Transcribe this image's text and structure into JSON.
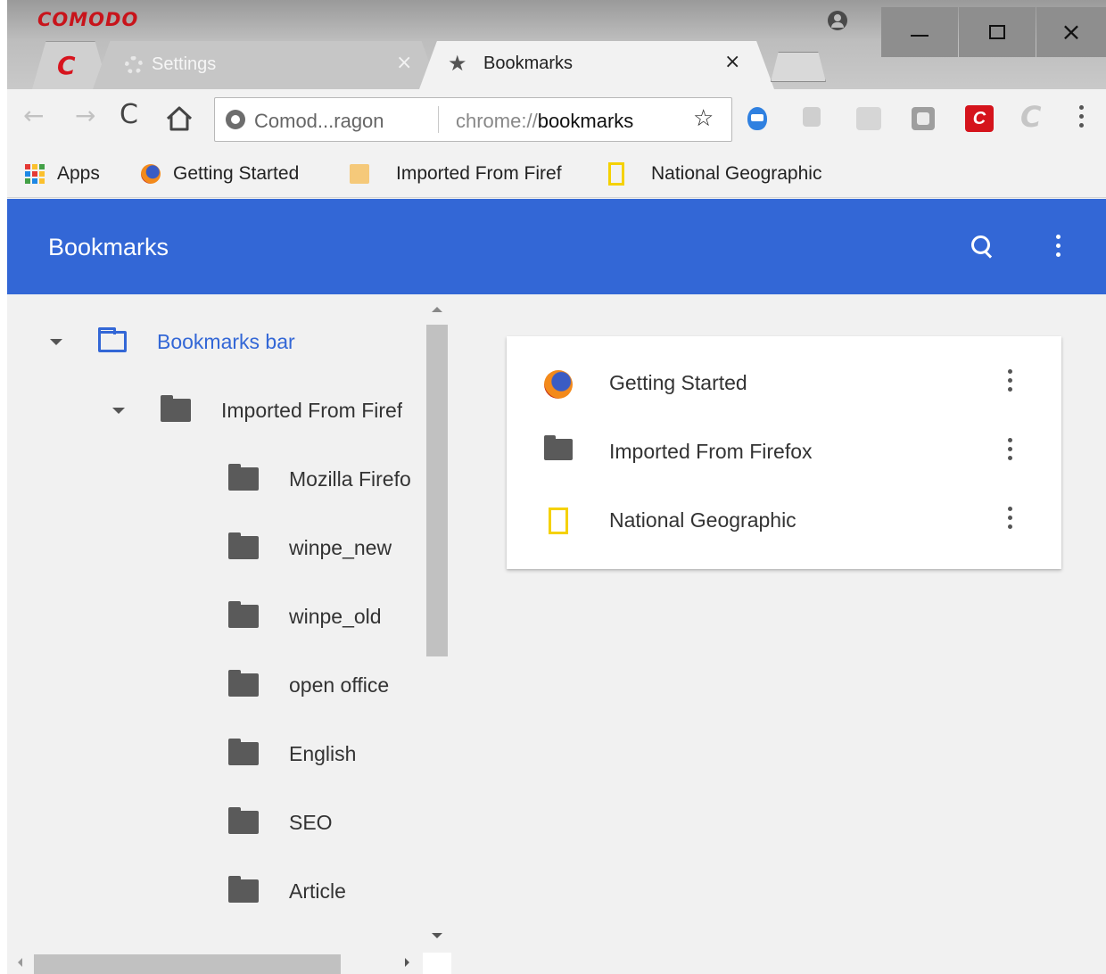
{
  "titlebar": {
    "brand": "COMODO",
    "window_controls": [
      "minimize",
      "maximize",
      "close"
    ]
  },
  "tabs": [
    {
      "label": "",
      "icon": "comodo-c-icon"
    },
    {
      "label": "Settings",
      "icon": "gear-icon",
      "close": "×"
    },
    {
      "label": "Bookmarks",
      "icon": "star-icon",
      "close": "×",
      "active": true
    }
  ],
  "toolbar": {
    "back": "←",
    "forward": "→",
    "reload": "C",
    "site_label": "Comod...ragon",
    "url_prefix": "chrome://",
    "url_path": "bookmarks",
    "star": "☆",
    "comodo_ext_label": "C",
    "comodo_ext2_label": "C"
  },
  "bookmarks_bar": {
    "items": [
      {
        "label": "Apps",
        "icon": "apps-grid-icon"
      },
      {
        "label": "Getting Started",
        "icon": "firefox-icon"
      },
      {
        "label": "Imported From Firef",
        "icon": "folder-icon"
      },
      {
        "label": "National Geographic",
        "icon": "natgeo-icon"
      }
    ]
  },
  "appbar": {
    "title": "Bookmarks"
  },
  "sidebar": {
    "items": [
      {
        "label": "Bookmarks bar",
        "selected": true
      },
      {
        "label": "Imported From Firef"
      },
      {
        "label": "Mozilla Firefo"
      },
      {
        "label": "winpe_new"
      },
      {
        "label": "winpe_old"
      },
      {
        "label": "open office"
      },
      {
        "label": "English"
      },
      {
        "label": "SEO"
      },
      {
        "label": "Article"
      }
    ]
  },
  "list": {
    "items": [
      {
        "label": "Getting Started",
        "icon": "firefox-icon"
      },
      {
        "label": "Imported From Firefox",
        "icon": "folder-icon"
      },
      {
        "label": "National Geographic",
        "icon": "natgeo-icon"
      }
    ]
  },
  "colors": {
    "accent": "#3367d6",
    "brand_red": "#c8141b",
    "natgeo_yellow": "#f5d100"
  }
}
